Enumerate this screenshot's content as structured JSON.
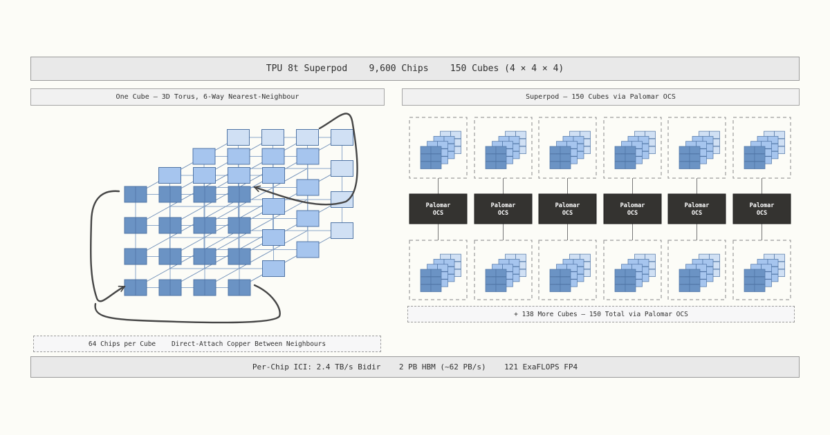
{
  "header": {
    "title": "TPU 8t Superpod    9,600 Chips    150 Cubes (4 × 4 × 4)"
  },
  "cube_panel": {
    "title": "One Cube — 3D Torus, 6-Way Nearest-Neighbour",
    "note": "64 Chips per Cube    Direct-Attach Copper Between Neighbours"
  },
  "superpod_panel": {
    "title": "Superpod — 150 Cubes via Palomar OCS",
    "ocs_label_line1": "Palomar",
    "ocs_label_line2": "OCS",
    "ocs_count": 6,
    "more_note": "+ 138 More Cubes — 150 Total via Palomar OCS"
  },
  "footer": {
    "stats": "Per-Chip ICI: 2.4 TB/s Bidir    2 PB HBM (~62 PB/s)    121 ExaFLOPS FP4"
  },
  "colors": {
    "chip_front": "#6b93c4",
    "chip_mid": "#a6c5ee",
    "chip_back": "#d0e0f4",
    "chip_stroke": "#4f74a5",
    "ocs_fill": "#343330",
    "arrow": "#454545"
  }
}
